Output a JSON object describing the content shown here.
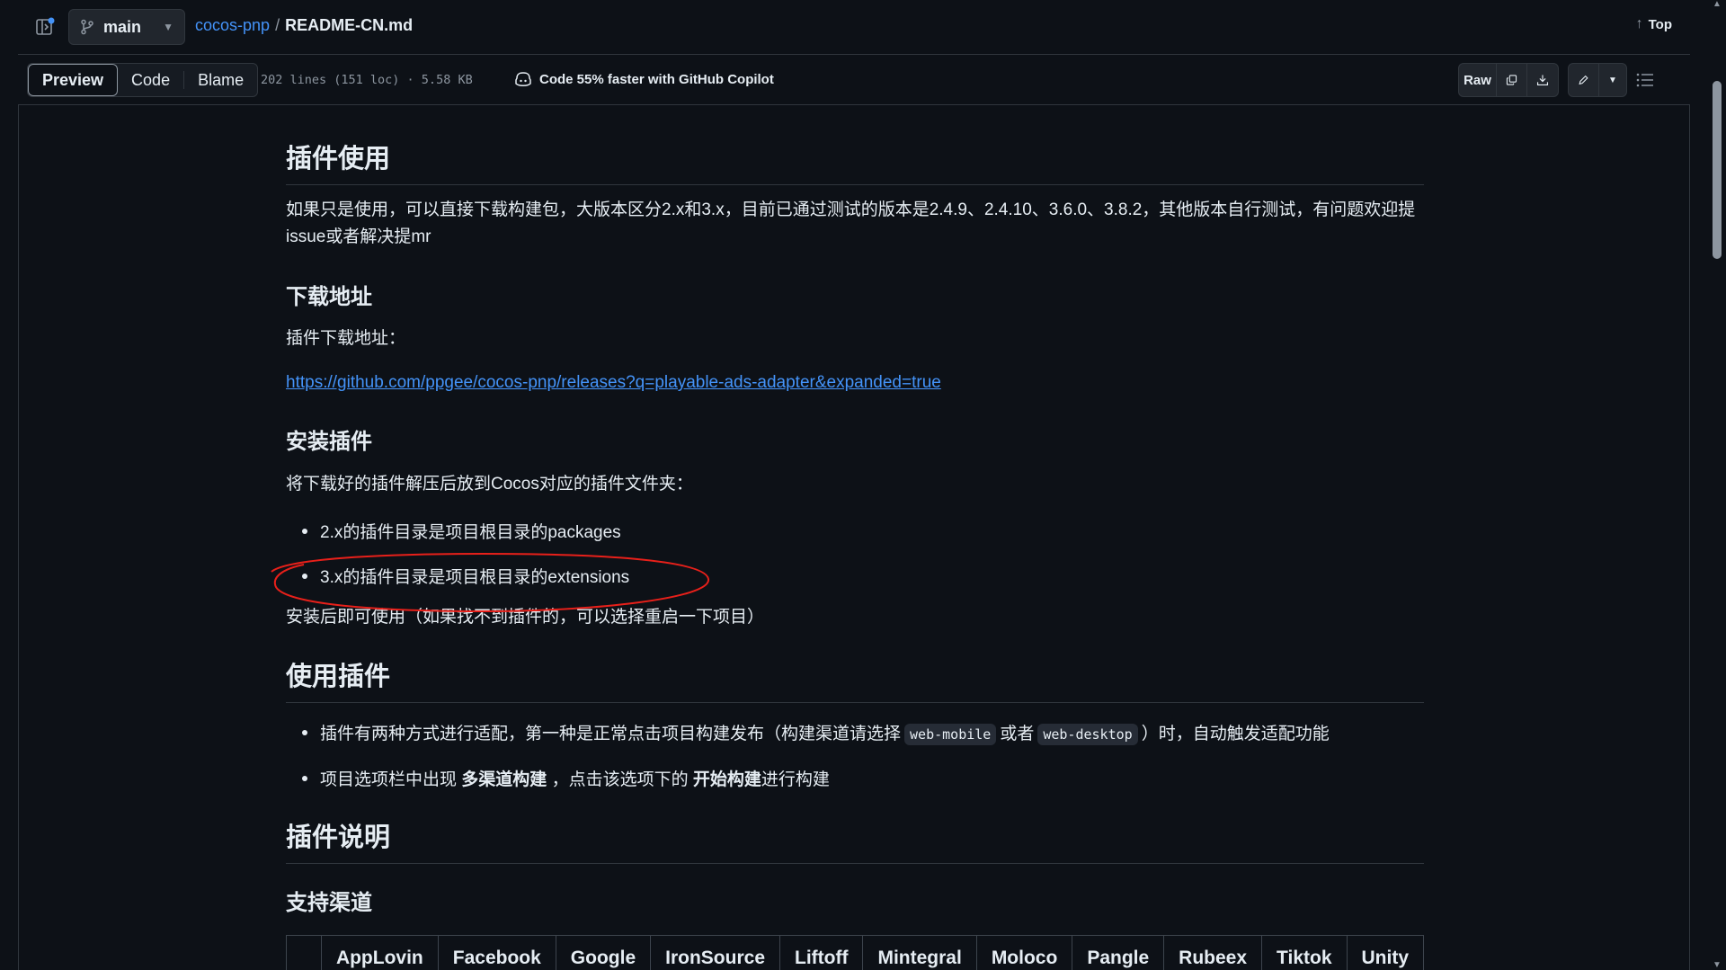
{
  "header": {
    "branch": "main",
    "repo": "cocos-pnp",
    "separator": "/",
    "file": "README-CN.md",
    "top_label": "Top"
  },
  "toolbar": {
    "tabs": [
      "Preview",
      "Code",
      "Blame"
    ],
    "meta": "202 lines (151 loc) · 5.58 KB",
    "copilot": "Code 55% faster with GitHub Copilot",
    "raw": "Raw"
  },
  "content": {
    "h_usage": "插件使用",
    "usage_text": "如果只是使用，可以直接下载构建包，大版本区分2.x和3.x，目前已通过测试的版本是2.4.9、2.4.10、3.6.0、3.8.2，其他版本自行测试，有问题欢迎提issue或者解决提mr",
    "h_download": "下载地址",
    "download_label": "插件下载地址：",
    "download_link": "https://github.com/ppgee/cocos-pnp/releases?q=playable-ads-adapter&expanded=true",
    "h_install": "安装插件",
    "install_text": "将下载好的插件解压后放到Cocos对应的插件文件夹：",
    "install_items": [
      "2.x的插件目录是项目根目录的packages",
      "3.x的插件目录是项目根目录的extensions"
    ],
    "install_after": "安装后即可使用（如果找不到插件的，可以选择重启一下项目）",
    "h_use": "使用插件",
    "use_item1_a": "插件有两种方式进行适配，第一种是正常点击项目构建发布（构建渠道请选择",
    "use_code1": "web-mobile",
    "use_item1_b": "或者",
    "use_code2": "web-desktop",
    "use_item1_c": "）时，自动触发适配功能",
    "use_item2_a": "项目选项栏中出现",
    "use_item2_b": "多渠道构建",
    "use_item2_c": "，点击该选项下的",
    "use_item2_d": "开始构建",
    "use_item2_e": "进行构建",
    "h_desc": "插件说明",
    "h_channels": "支持渠道",
    "channels": [
      "",
      "AppLovin",
      "Facebook",
      "Google",
      "IronSource",
      "Liftoff",
      "Mintegral",
      "Moloco",
      "Pangle",
      "Rubeex",
      "Tiktok",
      "Unity"
    ]
  }
}
